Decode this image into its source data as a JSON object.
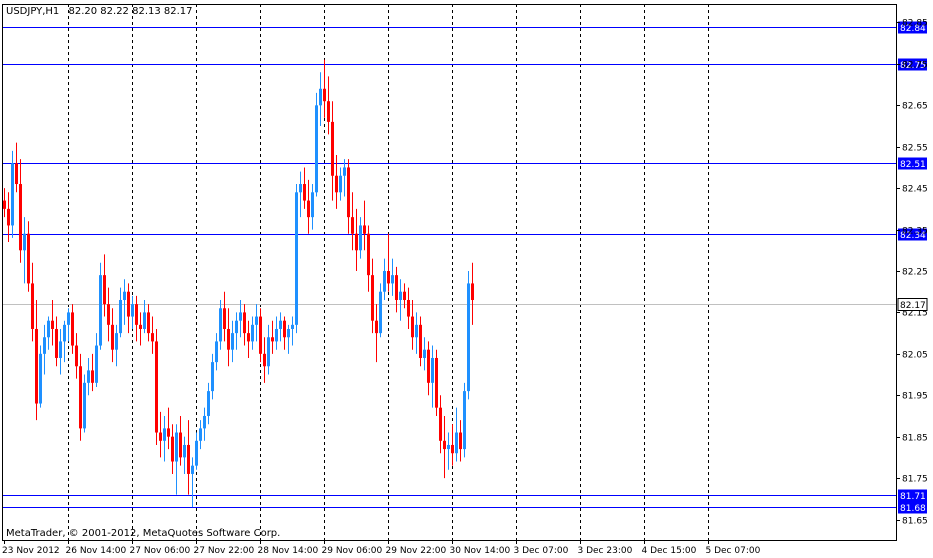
{
  "header": {
    "symbol": "USDJPY,H1",
    "ohlc": "82.20 82.22 82.13 82.17"
  },
  "watermark": "MetaTrader, © 2001-2012, MetaQuotes Software Corp.",
  "colors": {
    "background": "#ffffff",
    "frame": "#000000",
    "grid": "#000000",
    "bull": "#1e90ff",
    "bear": "#ff0000",
    "level_line": "#0000ff",
    "current_line": "#c0c0c0"
  },
  "chart_data": {
    "type": "candlestick",
    "symbol": "USDJPY",
    "timeframe": "H1",
    "grid": true,
    "ylim": [
      81.63,
      82.87
    ],
    "y_ticks": [
      82.85,
      82.75,
      82.65,
      82.55,
      82.45,
      82.35,
      82.25,
      82.15,
      82.05,
      81.95,
      81.85,
      81.75,
      81.65
    ],
    "x_ticks": [
      "23 Nov 2012",
      "26 Nov 14:00",
      "27 Nov 06:00",
      "27 Nov 22:00",
      "28 Nov 14:00",
      "29 Nov 06:00",
      "29 Nov 22:00",
      "30 Nov 14:00",
      "3 Dec 07:00",
      "3 Dec 23:00",
      "4 Dec 15:00",
      "5 Dec 07:00"
    ],
    "x_tick_bars": [
      0,
      16,
      32,
      48,
      64,
      80,
      96,
      112,
      128,
      144,
      160,
      176
    ],
    "levels": [
      {
        "value": 82.84,
        "label": "82.84"
      },
      {
        "value": 82.75,
        "label": "82.75"
      },
      {
        "value": 82.51,
        "label": "82.51"
      },
      {
        "value": 82.34,
        "label": "82.34"
      },
      {
        "value": 81.71,
        "label": "81.71"
      },
      {
        "value": 81.68,
        "label": "81.68"
      }
    ],
    "current_price": {
      "value": 82.17,
      "label": "82.17"
    },
    "ohlc": [
      [
        82.42,
        82.45,
        82.38,
        82.4
      ],
      [
        82.4,
        82.44,
        82.32,
        82.36
      ],
      [
        82.36,
        82.54,
        82.33,
        82.51
      ],
      [
        82.51,
        82.56,
        82.44,
        82.46
      ],
      [
        82.46,
        82.52,
        82.27,
        82.3
      ],
      [
        82.3,
        82.38,
        82.22,
        82.34
      ],
      [
        82.34,
        82.37,
        82.2,
        82.22
      ],
      [
        82.22,
        82.27,
        82.08,
        82.11
      ],
      [
        82.11,
        82.18,
        81.89,
        81.93
      ],
      [
        81.93,
        82.07,
        81.92,
        82.05
      ],
      [
        82.05,
        82.12,
        82.0,
        82.09
      ],
      [
        82.09,
        82.14,
        82.06,
        82.13
      ],
      [
        82.13,
        82.18,
        82.07,
        82.11
      ],
      [
        82.11,
        82.14,
        82.02,
        82.04
      ],
      [
        82.04,
        82.11,
        82.0,
        82.08
      ],
      [
        82.08,
        82.13,
        82.03,
        82.12
      ],
      [
        82.12,
        82.16,
        82.08,
        82.15
      ],
      [
        82.15,
        82.17,
        82.05,
        82.07
      ],
      [
        82.07,
        82.1,
        81.99,
        82.02
      ],
      [
        82.02,
        82.05,
        81.84,
        81.87
      ],
      [
        81.87,
        82.0,
        81.86,
        81.98
      ],
      [
        81.98,
        82.04,
        81.95,
        82.01
      ],
      [
        82.01,
        82.05,
        81.96,
        81.98
      ],
      [
        81.98,
        82.1,
        81.97,
        82.07
      ],
      [
        82.07,
        82.27,
        82.06,
        82.24
      ],
      [
        82.24,
        82.29,
        82.14,
        82.17
      ],
      [
        82.17,
        82.21,
        82.08,
        82.12
      ],
      [
        82.12,
        82.16,
        82.03,
        82.06
      ],
      [
        82.06,
        82.12,
        82.02,
        82.1
      ],
      [
        82.1,
        82.21,
        82.09,
        82.18
      ],
      [
        82.18,
        82.23,
        82.12,
        82.2
      ],
      [
        82.2,
        82.22,
        82.1,
        82.14
      ],
      [
        82.14,
        82.19,
        82.11,
        82.17
      ],
      [
        82.17,
        82.19,
        82.08,
        82.12
      ],
      [
        82.12,
        82.15,
        82.07,
        82.11
      ],
      [
        82.11,
        82.18,
        82.1,
        82.15
      ],
      [
        82.15,
        82.17,
        82.08,
        82.1
      ],
      [
        82.1,
        82.14,
        82.05,
        82.08
      ],
      [
        82.08,
        82.11,
        81.83,
        81.86
      ],
      [
        81.86,
        81.91,
        81.8,
        81.84
      ],
      [
        81.84,
        81.9,
        81.79,
        81.87
      ],
      [
        81.87,
        81.92,
        81.82,
        81.85
      ],
      [
        81.85,
        81.88,
        81.76,
        81.79
      ],
      [
        81.79,
        81.88,
        81.71,
        81.86
      ],
      [
        81.86,
        81.9,
        81.78,
        81.8
      ],
      [
        81.8,
        81.85,
        81.76,
        81.83
      ],
      [
        81.83,
        81.89,
        81.71,
        81.76
      ],
      [
        81.76,
        81.8,
        81.68,
        81.78
      ],
      [
        81.78,
        81.86,
        81.77,
        81.84
      ],
      [
        81.84,
        81.89,
        81.82,
        81.87
      ],
      [
        81.87,
        81.92,
        81.84,
        81.9
      ],
      [
        81.9,
        81.98,
        81.88,
        81.96
      ],
      [
        81.96,
        82.05,
        81.94,
        82.03
      ],
      [
        82.03,
        82.1,
        82.01,
        82.08
      ],
      [
        82.08,
        82.18,
        82.06,
        82.16
      ],
      [
        82.16,
        82.2,
        82.08,
        82.11
      ],
      [
        82.11,
        82.16,
        82.02,
        82.06
      ],
      [
        82.06,
        82.13,
        82.03,
        82.1
      ],
      [
        82.1,
        82.15,
        82.06,
        82.13
      ],
      [
        82.13,
        82.18,
        82.09,
        82.15
      ],
      [
        82.15,
        82.17,
        82.07,
        82.1
      ],
      [
        82.1,
        82.13,
        82.04,
        82.08
      ],
      [
        82.08,
        82.14,
        82.06,
        82.12
      ],
      [
        82.12,
        82.17,
        82.08,
        82.14
      ],
      [
        82.14,
        82.16,
        82.03,
        82.05
      ],
      [
        82.05,
        82.09,
        81.98,
        82.02
      ],
      [
        82.02,
        82.12,
        82.0,
        82.09
      ],
      [
        82.09,
        82.13,
        82.05,
        82.08
      ],
      [
        82.08,
        82.14,
        82.06,
        82.11
      ],
      [
        82.11,
        82.15,
        82.08,
        82.13
      ],
      [
        82.13,
        82.14,
        82.06,
        82.09
      ],
      [
        82.09,
        82.12,
        82.05,
        82.11
      ],
      [
        82.11,
        82.14,
        82.07,
        82.12
      ],
      [
        82.12,
        82.46,
        82.1,
        82.44
      ],
      [
        82.44,
        82.49,
        82.38,
        82.46
      ],
      [
        82.46,
        82.5,
        82.4,
        82.42
      ],
      [
        82.42,
        82.47,
        82.34,
        82.38
      ],
      [
        82.38,
        82.46,
        82.35,
        82.44
      ],
      [
        82.44,
        82.68,
        82.43,
        82.65
      ],
      [
        82.65,
        82.73,
        82.6,
        82.69
      ],
      [
        82.69,
        82.76,
        82.62,
        82.66
      ],
      [
        82.66,
        82.72,
        82.58,
        82.61
      ],
      [
        82.61,
        82.66,
        82.42,
        82.48
      ],
      [
        82.48,
        82.53,
        82.4,
        82.44
      ],
      [
        82.44,
        82.5,
        82.42,
        82.48
      ],
      [
        82.48,
        82.52,
        82.43,
        82.5
      ],
      [
        82.5,
        82.52,
        82.34,
        82.38
      ],
      [
        82.38,
        82.44,
        82.3,
        82.34
      ],
      [
        82.34,
        82.4,
        82.25,
        82.3
      ],
      [
        82.3,
        82.38,
        82.28,
        82.36
      ],
      [
        82.36,
        82.42,
        82.3,
        82.34
      ],
      [
        82.34,
        82.36,
        82.2,
        82.24
      ],
      [
        82.24,
        82.28,
        82.1,
        82.13
      ],
      [
        82.13,
        82.17,
        82.03,
        82.1
      ],
      [
        82.1,
        82.22,
        82.09,
        82.2
      ],
      [
        82.2,
        82.28,
        82.18,
        82.25
      ],
      [
        82.25,
        82.34,
        82.2,
        82.22
      ],
      [
        82.22,
        82.28,
        82.19,
        82.24
      ],
      [
        82.24,
        82.26,
        82.15,
        82.18
      ],
      [
        82.18,
        82.23,
        82.13,
        82.2
      ],
      [
        82.2,
        82.22,
        82.16,
        82.18
      ],
      [
        82.18,
        82.21,
        82.11,
        82.14
      ],
      [
        82.14,
        82.18,
        82.06,
        82.09
      ],
      [
        82.09,
        82.15,
        82.05,
        82.12
      ],
      [
        82.12,
        82.14,
        82.02,
        82.04
      ],
      [
        82.04,
        82.09,
        82.01,
        82.06
      ],
      [
        82.06,
        82.08,
        81.95,
        81.98
      ],
      [
        81.98,
        82.07,
        81.92,
        82.04
      ],
      [
        82.04,
        82.06,
        81.9,
        81.92
      ],
      [
        81.92,
        81.95,
        81.81,
        81.84
      ],
      [
        81.84,
        81.9,
        81.75,
        81.82
      ],
      [
        81.82,
        81.86,
        81.77,
        81.83
      ],
      [
        81.83,
        81.88,
        81.78,
        81.81
      ],
      [
        81.81,
        81.92,
        81.79,
        81.86
      ],
      [
        81.86,
        81.89,
        81.79,
        81.82
      ],
      [
        81.82,
        81.98,
        81.8,
        81.96
      ],
      [
        81.96,
        82.25,
        81.94,
        82.22
      ],
      [
        82.22,
        82.27,
        82.12,
        82.18
      ]
    ]
  }
}
